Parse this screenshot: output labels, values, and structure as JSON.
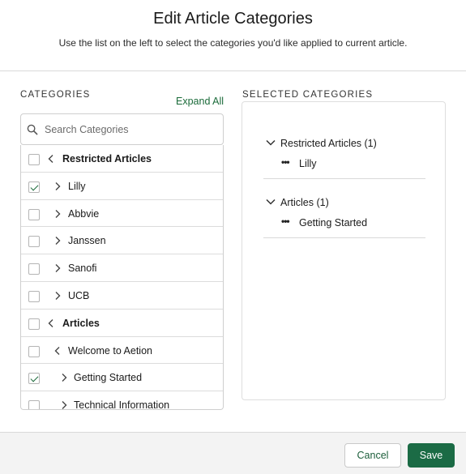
{
  "dialog": {
    "title": "Edit Article Categories",
    "subtitle": "Use the list on the left to select the categories you'd like applied to current article."
  },
  "categories": {
    "label": "CATEGORIES",
    "expand_all": "Expand All",
    "search_placeholder": "Search Categories",
    "rows": [
      {
        "label": "Restricted Articles",
        "bold": true,
        "checked": false,
        "expanded": true,
        "indent": 0
      },
      {
        "label": "Lilly",
        "bold": false,
        "checked": true,
        "expanded": false,
        "indent": 1
      },
      {
        "label": "Abbvie",
        "bold": false,
        "checked": false,
        "expanded": false,
        "indent": 1
      },
      {
        "label": "Janssen",
        "bold": false,
        "checked": false,
        "expanded": false,
        "indent": 1
      },
      {
        "label": "Sanofi",
        "bold": false,
        "checked": false,
        "expanded": false,
        "indent": 1
      },
      {
        "label": "UCB",
        "bold": false,
        "checked": false,
        "expanded": false,
        "indent": 1
      },
      {
        "label": "Articles",
        "bold": true,
        "checked": false,
        "expanded": true,
        "indent": 0
      },
      {
        "label": "Welcome to Aetion",
        "bold": false,
        "checked": false,
        "expanded": true,
        "indent": 1
      },
      {
        "label": "Getting Started",
        "bold": false,
        "checked": true,
        "expanded": false,
        "indent": 2
      },
      {
        "label": "Technical Information",
        "bold": false,
        "checked": false,
        "expanded": false,
        "indent": 2
      }
    ]
  },
  "selected": {
    "label": "SELECTED CATEGORIES",
    "groups": [
      {
        "title": "Restricted Articles (1)",
        "item": "Lilly"
      },
      {
        "title": "Articles (1)",
        "item": "Getting Started"
      }
    ]
  },
  "footer": {
    "cancel_label": "Cancel",
    "save_label": "Save"
  },
  "colors": {
    "accent": "#1b6b45",
    "link": "#1b6b3a"
  }
}
